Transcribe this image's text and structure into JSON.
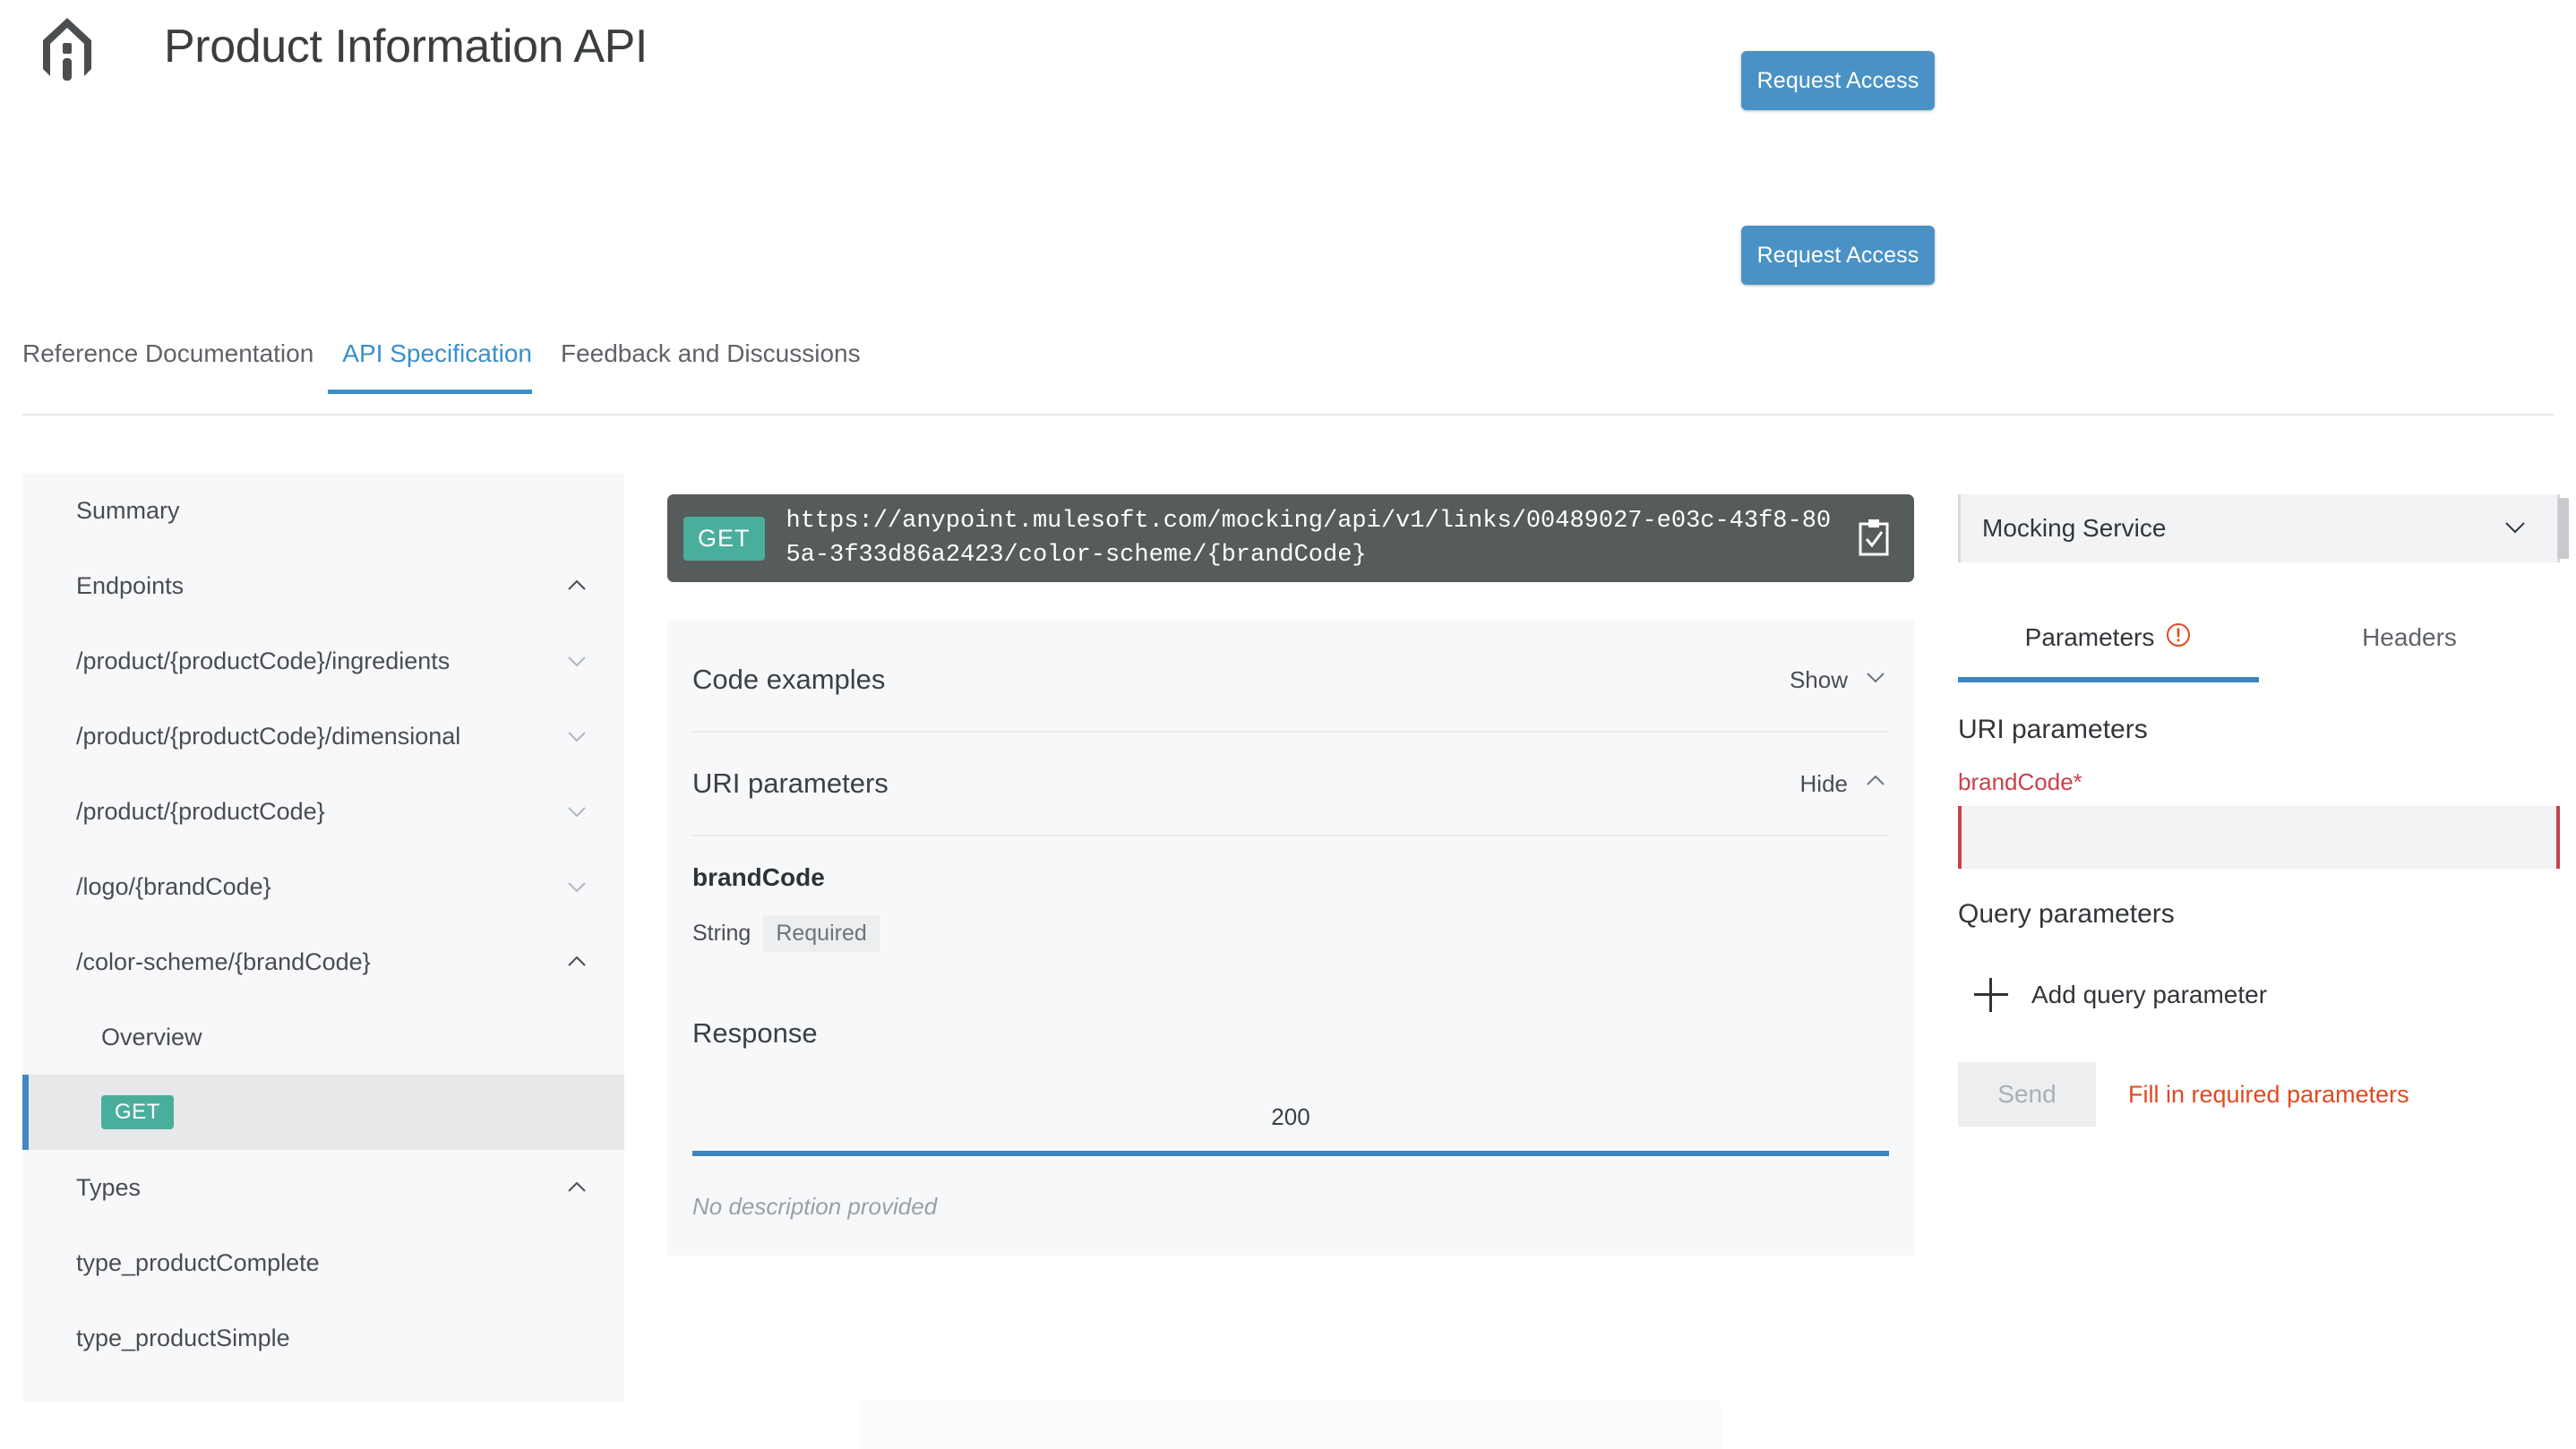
{
  "header": {
    "title": "Product Information API",
    "logo_icon": "house-info-logo-icon",
    "request_access_primary": "Request Access",
    "request_access_secondary": "Request Access"
  },
  "tabs": [
    {
      "label": "Reference Documentation",
      "active": false
    },
    {
      "label": "API Specification",
      "active": true
    },
    {
      "label": "Feedback and Discussions",
      "active": false
    }
  ],
  "sidebar": {
    "items": [
      {
        "label": "Summary",
        "chevron": "none",
        "indent": false,
        "selected": false,
        "badge": null
      },
      {
        "label": "Endpoints",
        "chevron": "up",
        "indent": false,
        "selected": false,
        "badge": null
      },
      {
        "label": "/product/{productCode}/ingredients",
        "chevron": "down",
        "indent": false,
        "selected": false,
        "badge": null
      },
      {
        "label": "/product/{productCode}/dimensional",
        "chevron": "down",
        "indent": false,
        "selected": false,
        "badge": null
      },
      {
        "label": "/product/{productCode}",
        "chevron": "down",
        "indent": false,
        "selected": false,
        "badge": null
      },
      {
        "label": "/logo/{brandCode}",
        "chevron": "down",
        "indent": false,
        "selected": false,
        "badge": null
      },
      {
        "label": "/color-scheme/{brandCode}",
        "chevron": "up",
        "indent": false,
        "selected": false,
        "badge": null
      },
      {
        "label": "Overview",
        "chevron": "none",
        "indent": true,
        "selected": false,
        "badge": null
      },
      {
        "label": "",
        "chevron": "none",
        "indent": true,
        "selected": true,
        "badge": "GET"
      },
      {
        "label": "Types",
        "chevron": "up",
        "indent": false,
        "selected": false,
        "badge": null
      },
      {
        "label": "type_productComplete",
        "chevron": "none",
        "indent": false,
        "selected": false,
        "badge": null
      },
      {
        "label": "type_productSimple",
        "chevron": "none",
        "indent": false,
        "selected": false,
        "badge": null
      }
    ]
  },
  "endpoint": {
    "method": "GET",
    "url": "https://anypoint.mulesoft.com/mocking/api/v1/links/00489027-e03c-43f8-805a-3f33d86a2423/color-scheme/{brandCode}",
    "copy_icon": "clipboard-check-icon"
  },
  "detail": {
    "code_examples": {
      "title": "Code examples",
      "toggle": "Show",
      "chevron": "down"
    },
    "uri_parameters": {
      "title": "URI parameters",
      "toggle": "Hide",
      "chevron": "up"
    },
    "parameter": {
      "name": "brandCode",
      "type": "String",
      "required_flag": "Required"
    },
    "response": {
      "title": "Response",
      "status_code": "200",
      "description": "No description provided"
    }
  },
  "right_panel": {
    "service": {
      "value": "Mocking Service",
      "chevron": "down"
    },
    "tabs": [
      {
        "label": "Parameters",
        "active": true,
        "warning_icon": "exclamation-circle-icon"
      },
      {
        "label": "Headers",
        "active": false,
        "warning_icon": null
      }
    ],
    "uri_parameters_heading": "URI parameters",
    "brand_code": {
      "label": "brandCode*",
      "value": "",
      "placeholder": ""
    },
    "query_parameters_heading": "Query parameters",
    "add_query_parameter": "Add query parameter",
    "send_button": "Send",
    "send_hint": "Fill in required parameters"
  },
  "colors": {
    "accent_blue": "#3a8fc8",
    "button_blue": "#4a92c6",
    "method_teal": "#4aae9c",
    "url_bar_dark": "#565b5c",
    "error_red": "#c8414c",
    "hint_orange": "#e04a21",
    "panel_grey": "#f7f8fa"
  }
}
